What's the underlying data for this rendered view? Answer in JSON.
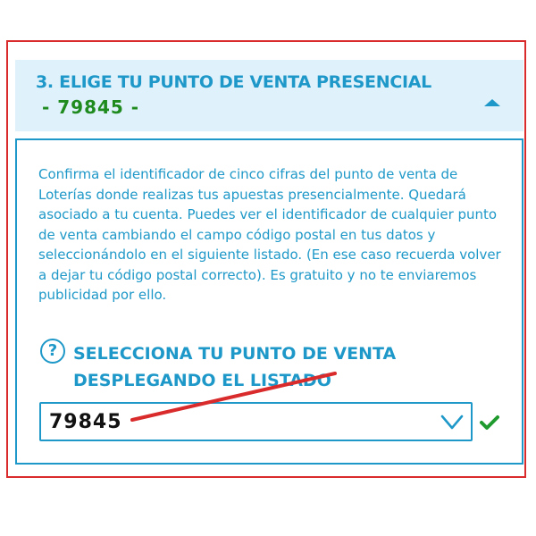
{
  "section": {
    "title": "3. ELIGE TU PUNTO DE VENTA PRESENCIAL",
    "highlight_code": "- 79845 -",
    "collapse_icon": "caret-up-icon"
  },
  "description": "Confirma el identificador de cinco cifras del punto de venta de Loterías donde realizas tus apuestas presencialmente. Quedará asociado a tu cuenta. Puedes ver el identificador de cualquier punto de venta cambiando el campo código postal en tus datos y seleccionándolo en el siguiente listado. (En ese caso recuerda volver a dejar tu código postal correcto). Es gratuito y no te enviaremos publicidad por ello.",
  "selector": {
    "help_icon_glyph": "?",
    "label": "SELECCIONA TU PUNTO DE VENTA DESPLEGANDO EL LISTADO",
    "selected_value": "79845",
    "chevron_icon": "chevron-down-icon",
    "valid_icon": "check-icon"
  },
  "colors": {
    "accent": "#1e98c8",
    "header_bg": "#dff1fb",
    "highlight_green": "#1f8b1f",
    "annotation_red": "#d92b2b",
    "check_green": "#1f9a2e"
  }
}
